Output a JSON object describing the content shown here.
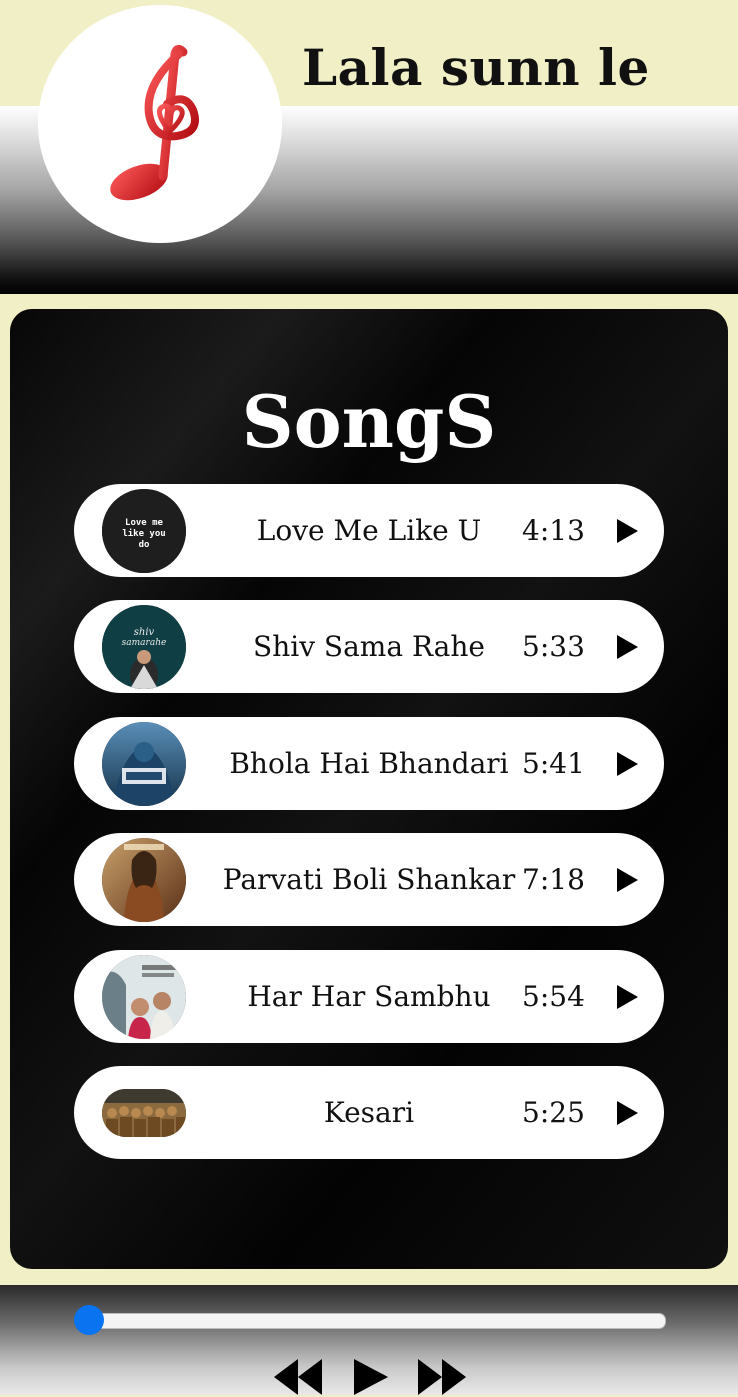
{
  "app": {
    "title": "Lala sunn le",
    "logo_icon": "music-note-heart-icon",
    "accent_color": "#e8262a"
  },
  "playlist": {
    "title": "SongS",
    "songs": [
      {
        "name": "Love Me Like U",
        "duration": "4:13",
        "thumb_text": "Love me like you do"
      },
      {
        "name": "Shiv Sama Rahe",
        "duration": "5:33",
        "thumb_text": "shiv samarahe"
      },
      {
        "name": "Bhola Hai Bhandari",
        "duration": "5:41"
      },
      {
        "name": "Parvati Boli Shankar",
        "duration": "7:18"
      },
      {
        "name": "Har Har Sambhu",
        "duration": "5:54"
      },
      {
        "name": "Kesari",
        "duration": "5:25"
      }
    ]
  },
  "player": {
    "progress": 0.0,
    "slider_color": "#0a74f0",
    "controls": [
      "rewind-icon",
      "play-icon",
      "fast-forward-icon"
    ]
  }
}
